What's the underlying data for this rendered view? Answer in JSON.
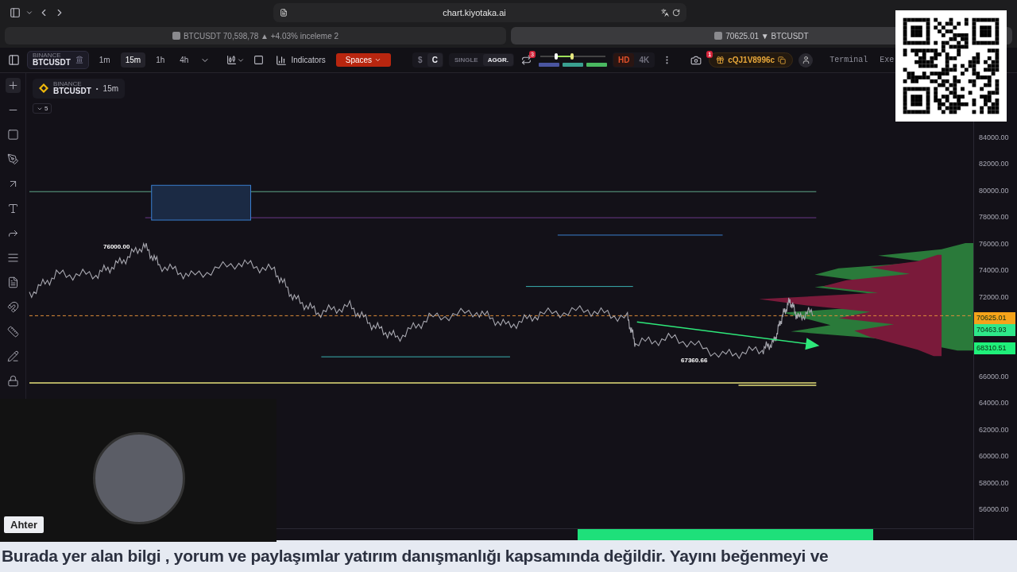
{
  "browser": {
    "url": "chart.kiyotaka.ai",
    "tabs": [
      {
        "title": "BTCUSDT 70,598,78 ▲ +4.03% inceleme 2",
        "selected": false
      },
      {
        "title": "70625.01 ▼ BTCUSDT",
        "selected": true
      }
    ]
  },
  "toolbar": {
    "exchange": "BINANCE",
    "symbol": "BTCUSDT",
    "timeframes": [
      {
        "label": "1m",
        "selected": false
      },
      {
        "label": "15m",
        "selected": true
      },
      {
        "label": "1h",
        "selected": false
      },
      {
        "label": "4h",
        "selected": false
      }
    ],
    "indicators": "Indicators",
    "spaces": "Spaces",
    "currency": [
      {
        "label": "$",
        "selected": false
      },
      {
        "label": "C",
        "selected": true
      }
    ],
    "mode": [
      {
        "label": "SINGLE",
        "selected": false
      },
      {
        "label": "AGGR.",
        "selected": true
      }
    ],
    "sync_badge": "3",
    "quality": [
      {
        "label": "HD",
        "selected": true
      },
      {
        "label": "4K",
        "selected": false
      }
    ],
    "referral": {
      "code": "cQJ1V8996c",
      "badge": "1"
    },
    "links": [
      "Terminal",
      "Exe"
    ]
  },
  "legend": {
    "exchange": "BINANCE",
    "symbol": "BTCUSDT",
    "separator": "•",
    "interval": "15m",
    "indicator_count": "5"
  },
  "price_axis": {
    "upper": [
      "84000.00",
      "82000.00",
      "80000.00",
      "78000.00",
      "76000.00",
      "74000.00",
      "72000.00"
    ],
    "lower": [
      "66000.00",
      "64000.00",
      "62000.00",
      "60000.00",
      "58000.00",
      "56000.00"
    ]
  },
  "price_tags": [
    {
      "value": "70625.01",
      "color": "#f5a31a"
    },
    {
      "value": "70463.93",
      "color": "#2ee88a"
    },
    {
      "value": "68310.51",
      "color": "#1ff07a"
    }
  ],
  "annotations": [
    "76000.00",
    "67360.66"
  ],
  "webcam": {
    "name": "Ahter"
  },
  "ticker": "Burada yer alan bilgi , yorum ve paylaşımlar yatırım danışmanlığı kapsamında değildir. Yayını beğenmeyi ve"
}
